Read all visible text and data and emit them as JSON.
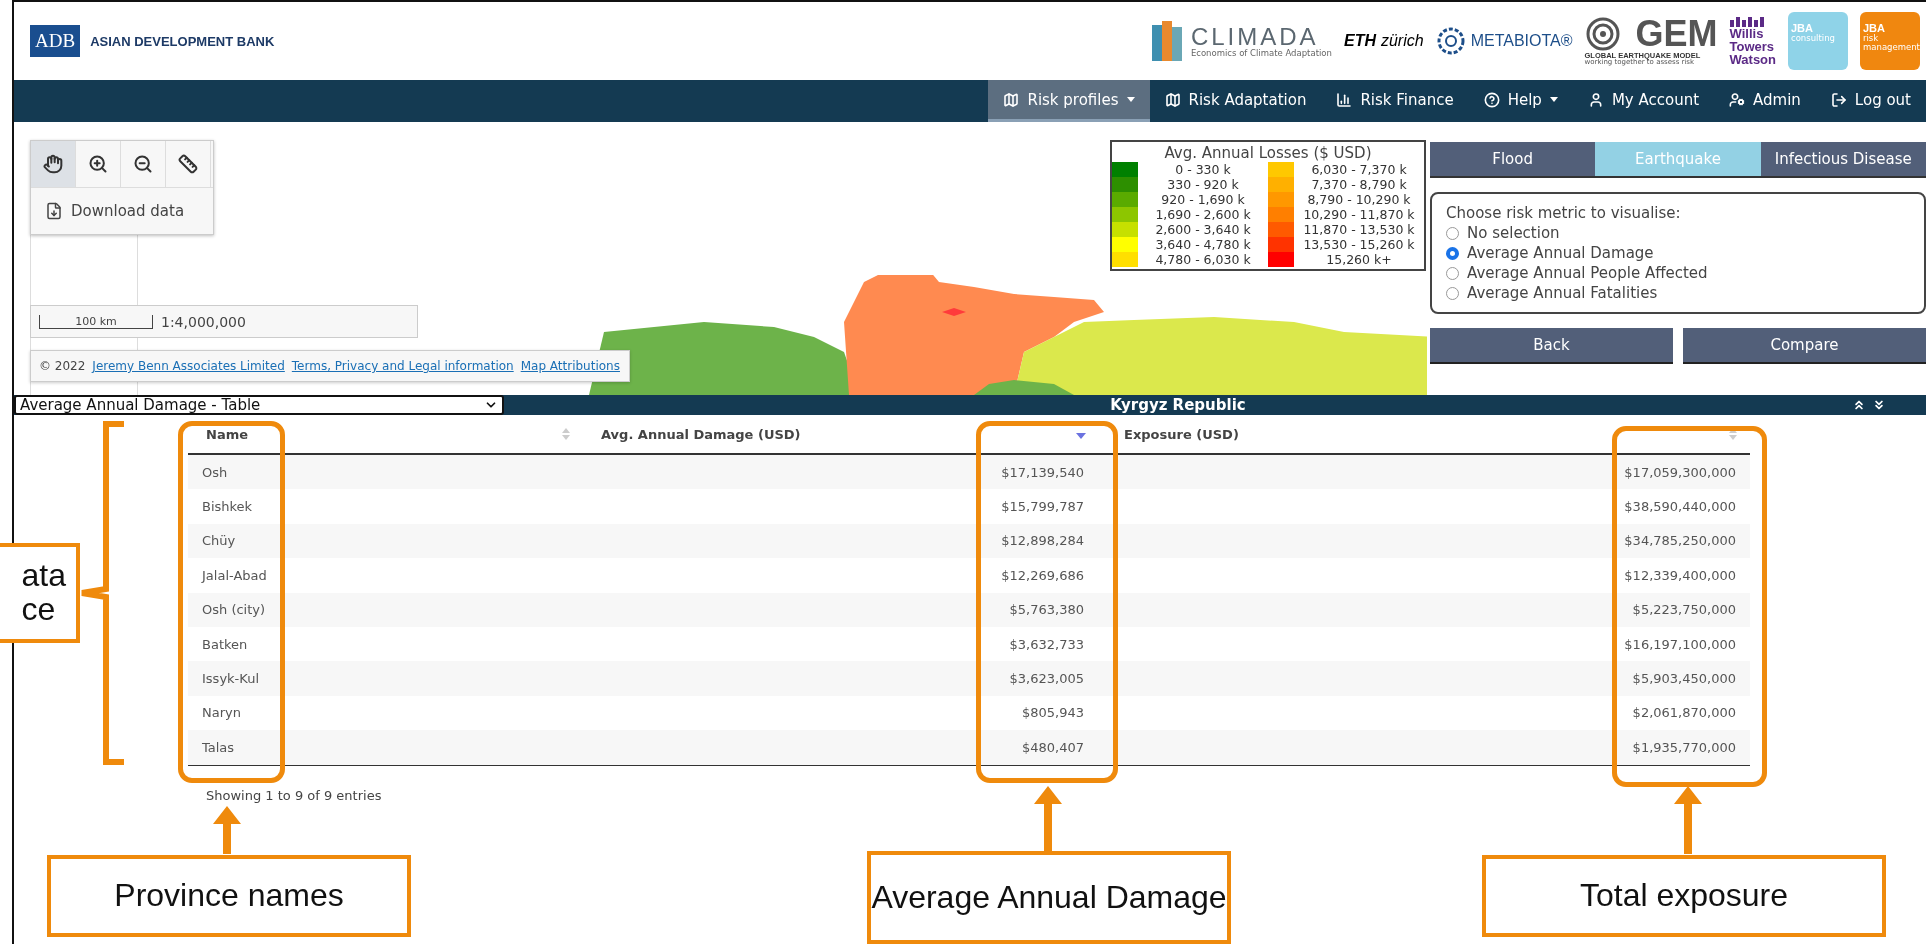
{
  "header": {
    "logo": {
      "mark": "ADB",
      "name": "ASIAN DEVELOPMENT BANK"
    },
    "partners": [
      {
        "kind": "climada",
        "title": "CLIMADA",
        "subtitle": "Economics of Climate Adaptation"
      },
      {
        "kind": "eth",
        "title": "ETH",
        "subtitle": "zürich"
      },
      {
        "kind": "metabiota",
        "title": "METABIOTA®"
      },
      {
        "kind": "gem",
        "title": "GEM",
        "subtitle": "GLOBAL EARTHQUAKE MODEL",
        "tagline": "working together to assess risk"
      },
      {
        "kind": "willis",
        "lines": [
          "Willis",
          "Towers",
          "Watson"
        ]
      },
      {
        "kind": "jba",
        "title": "JBA",
        "subtitle": "consulting",
        "color": "#8fd3e8"
      },
      {
        "kind": "jba",
        "title": "JBA",
        "subtitle": "risk management",
        "color": "#f0870f"
      }
    ]
  },
  "nav": [
    {
      "label": "Risk profiles",
      "dropdown": true,
      "selected": true
    },
    {
      "label": "Risk Adaptation",
      "dropdown": false,
      "selected": false
    },
    {
      "label": "Risk Finance",
      "dropdown": false,
      "selected": false
    },
    {
      "label": "Help",
      "dropdown": true,
      "selected": false
    },
    {
      "label": "My Account",
      "dropdown": false,
      "selected": false
    },
    {
      "label": "Admin",
      "dropdown": false,
      "selected": false
    },
    {
      "label": "Log out",
      "dropdown": false,
      "selected": false
    }
  ],
  "map": {
    "tools": [
      {
        "selected": true
      },
      {
        "selected": false
      },
      {
        "selected": false
      },
      {
        "selected": false
      }
    ],
    "download": "Download data",
    "scale": {
      "bar": "100 km",
      "ratio": "1:4,000,000"
    },
    "attribution": {
      "text": "© 2022",
      "links": [
        "Jeremy Benn Associates Limited",
        "Terms, Privacy and Legal information",
        "Map Attributions"
      ]
    },
    "legend": {
      "title": "Avg. Annual Losses ($ USD)",
      "items": [
        {
          "label": "0 - 330 k",
          "color": "#008000"
        },
        {
          "label": "330 - 920 k",
          "color": "#2d8f00"
        },
        {
          "label": "920 - 1,690 k",
          "color": "#5aab00"
        },
        {
          "label": "1,690 - 2,600 k",
          "color": "#8dc600"
        },
        {
          "label": "2,600 - 3,640 k",
          "color": "#c6e000"
        },
        {
          "label": "3,640 - 4,780 k",
          "color": "#ffff00"
        },
        {
          "label": "4,780 - 6,030 k",
          "color": "#ffdf00"
        },
        {
          "label": "6,030 - 7,370 k",
          "color": "#ffc800"
        },
        {
          "label": "7,370 - 8,790 k",
          "color": "#ffb000"
        },
        {
          "label": "8,790 - 10,290 k",
          "color": "#ff9800"
        },
        {
          "label": "10,290 - 11,870 k",
          "color": "#ff7f00"
        },
        {
          "label": "11,870 - 13,530 k",
          "color": "#ff5a00"
        },
        {
          "label": "13,530 - 15,260 k",
          "color": "#ff3300"
        },
        {
          "label": "15,260 k+",
          "color": "#ff0000"
        }
      ]
    }
  },
  "hazard_tabs": [
    {
      "label": "Flood",
      "selected": false
    },
    {
      "label": "Earthquake",
      "selected": true
    },
    {
      "label": "Infectious Disease",
      "selected": false
    }
  ],
  "metric": {
    "prompt": "Choose risk metric to visualise:",
    "options": [
      {
        "label": "No selection",
        "selected": false
      },
      {
        "label": "Average Annual Damage",
        "selected": true
      },
      {
        "label": "Average Annual People Affected",
        "selected": false
      },
      {
        "label": "Average Annual Fatalities",
        "selected": false
      }
    ]
  },
  "buttons": [
    "Back",
    "Compare"
  ],
  "table_bar": {
    "view": "Average Annual Damage - Table",
    "country": "Kyrgyz Republic"
  },
  "table": {
    "columns": [
      {
        "label": "Name",
        "sorted": false
      },
      {
        "label": "Avg. Annual Damage (USD)",
        "sorted": true
      },
      {
        "label": "Exposure (USD)",
        "sorted": false
      }
    ],
    "rows": [
      [
        "Osh",
        "$17,139,540",
        "$17,059,300,000"
      ],
      [
        "Bishkek",
        "$15,799,787",
        "$38,590,440,000"
      ],
      [
        "Chüy",
        "$12,898,284",
        "$34,785,250,000"
      ],
      [
        "Jalal-Abad",
        "$12,269,686",
        "$12,339,400,000"
      ],
      [
        "Osh (city)",
        "$5,763,380",
        "$5,223,750,000"
      ],
      [
        "Batken",
        "$3,632,733",
        "$16,197,100,000"
      ],
      [
        "Issyk-Kul",
        "$3,623,005",
        "$5,903,450,000"
      ],
      [
        "Naryn",
        "$805,943",
        "$2,061,870,000"
      ],
      [
        "Talas",
        "$480,407",
        "$1,935,770,000"
      ]
    ],
    "info": "Showing 1 to 9 of 9 entries"
  },
  "annotations": [
    {
      "text": "Province names"
    },
    {
      "text": "Average Annual Damage"
    },
    {
      "text": "Total exposure"
    },
    {
      "text": "ata\nce"
    }
  ]
}
